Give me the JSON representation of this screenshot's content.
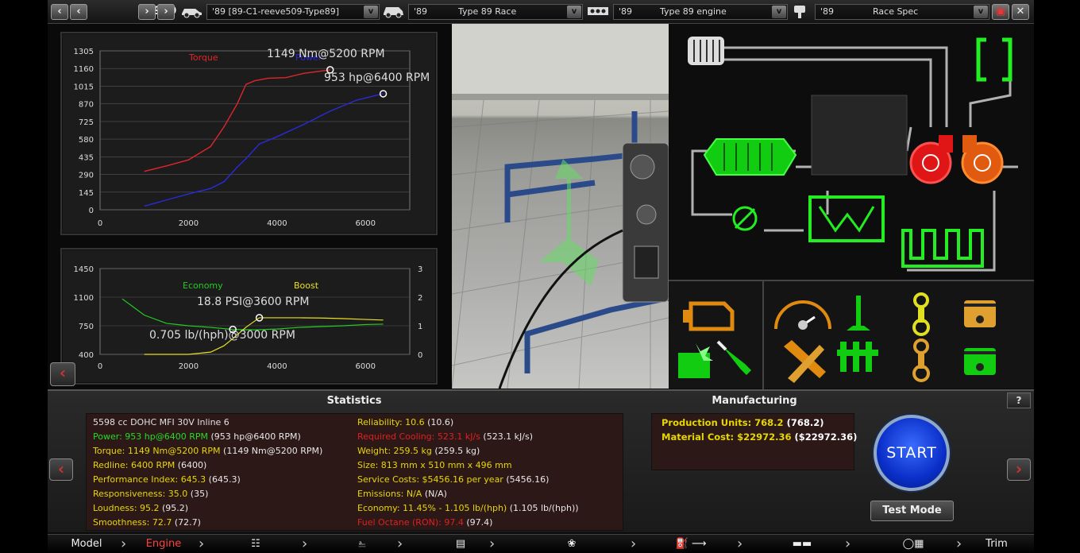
{
  "topbar": {
    "year": "1989",
    "model_select": "'89 [89-C1-reeve509-Type89]",
    "trim_select_year": "'89",
    "trim_select": "Type 89 Race",
    "engine_select_year": "'89",
    "engine_select": "Type 89 engine",
    "variant_select_year": "'89",
    "variant_select": "Race Spec"
  },
  "power_chart": {
    "legend_torque": "Torque",
    "legend_power": "Power",
    "torque_annotation": "1149 Nm@5200 RPM",
    "power_annotation": "953 hp@6400 RPM"
  },
  "eco_chart": {
    "legend_economy": "Economy",
    "legend_boost": "Boost",
    "boost_annotation": "18.8 PSI@3600 RPM",
    "economy_annotation": "0.705 lb/(hph)@3000 RPM"
  },
  "chart_data": [
    {
      "type": "line",
      "title": "",
      "xlabel": "",
      "ylabel": "",
      "x_ticks": [
        0,
        2000,
        4000,
        6000
      ],
      "y_ticks": [
        0,
        145,
        290,
        435,
        580,
        725,
        870,
        1015,
        1160,
        1305
      ],
      "xlim": [
        0,
        7000
      ],
      "ylim": [
        0,
        1305
      ],
      "series": [
        {
          "name": "Torque",
          "color": "#e0262a",
          "x": [
            1000,
            1500,
            2000,
            2500,
            2800,
            3100,
            3300,
            3500,
            3800,
            4200,
            4600,
            5200
          ],
          "y": [
            315,
            360,
            410,
            520,
            680,
            870,
            1030,
            1060,
            1080,
            1085,
            1120,
            1149
          ]
        },
        {
          "name": "Power",
          "color": "#2a2ad8",
          "x": [
            1000,
            1500,
            2000,
            2500,
            2800,
            3100,
            3300,
            3600,
            4000,
            4600,
            5200,
            5800,
            6400
          ],
          "y": [
            30,
            80,
            130,
            175,
            230,
            350,
            420,
            540,
            600,
            700,
            810,
            900,
            953
          ]
        }
      ]
    },
    {
      "type": "line",
      "title": "",
      "xlabel": "",
      "ylabel": "",
      "x_ticks": [
        0,
        2000,
        4000,
        6000
      ],
      "y_ticks_left": [
        400,
        750,
        1100,
        1450
      ],
      "y_ticks_right": [
        0,
        1,
        2,
        3
      ],
      "xlim": [
        0,
        7000
      ],
      "ylim_left": [
        400,
        1450
      ],
      "ylim_right": [
        0,
        3
      ],
      "series": [
        {
          "name": "Economy",
          "color": "#22cc22",
          "axis": "left",
          "x": [
            500,
            1000,
            1500,
            2000,
            2500,
            3000,
            3500,
            4000,
            4500,
            5000,
            5500,
            6000,
            6400
          ],
          "y": [
            1080,
            880,
            780,
            750,
            730,
            705,
            700,
            710,
            730,
            740,
            750,
            765,
            770
          ]
        },
        {
          "name": "Boost",
          "color": "#e8e020",
          "axis": "right",
          "x": [
            1000,
            2000,
            2500,
            2800,
            3000,
            3300,
            3600,
            4000,
            4500,
            5000,
            5500,
            6000,
            6400
          ],
          "y": [
            0,
            0,
            0.08,
            0.3,
            0.55,
            0.95,
            1.28,
            1.28,
            1.28,
            1.27,
            1.25,
            1.22,
            1.2
          ]
        }
      ]
    }
  ],
  "statistics": {
    "title": "Statistics",
    "col1": [
      {
        "label": "5598 cc DOHC MFI 30V Inline 6",
        "extra": "",
        "color": "#e0e0e0"
      },
      {
        "label": "Power: 953 hp@6400 RPM",
        "extra": " (953 hp@6400 RPM)",
        "color": "#22dd22"
      },
      {
        "label": "Torque: 1149 Nm@5200 RPM",
        "extra": " (1149 Nm@5200 RPM)",
        "color": "#e6d700"
      },
      {
        "label": "Redline: 6400 RPM",
        "extra": " (6400)",
        "color": "#e6d700"
      },
      {
        "label": "Performance Index: 645.3",
        "extra": " (645.3)",
        "color": "#e6d700"
      },
      {
        "label": "Responsiveness: 35.0",
        "extra": " (35)",
        "color": "#e6d700"
      },
      {
        "label": "Loudness: 95.2",
        "extra": " (95.2)",
        "color": "#e6d700"
      },
      {
        "label": "Smoothness: 72.7",
        "extra": " (72.7)",
        "color": "#e6d700"
      }
    ],
    "col2": [
      {
        "label": "Reliability: 10.6",
        "extra": " (10.6)",
        "color": "#e6d700"
      },
      {
        "label": "Required Cooling: 523.1 kJ/s",
        "extra": " (523.1 kJ/s)",
        "color": "#e02020"
      },
      {
        "label": "Weight: 259.5 kg",
        "extra": " (259.5 kg)",
        "color": "#e6d700"
      },
      {
        "label": "Size: 813 mm x 510 mm x 496 mm",
        "extra": "",
        "color": "#e6d700"
      },
      {
        "label": "Service Costs: $5456.16 per year",
        "extra": " (5456.16)",
        "color": "#e6d700"
      },
      {
        "label": "Emissions: N/A",
        "extra": " (N/A)",
        "color": "#e6d700"
      },
      {
        "label": "Economy: 11.45% - 1.105 lb/(hph)",
        "extra": " (1.105 lb/(hph))",
        "color": "#e6d700"
      },
      {
        "label": "Fuel Octane (RON): 97.4",
        "extra": " (97.4)",
        "color": "#e02020"
      }
    ]
  },
  "manufacturing": {
    "title": "Manufacturing",
    "units_label": "Production Units: 768.2",
    "units_extra": " (768.2)",
    "cost_label": "Material Cost: $22972.36",
    "cost_extra": " ($22972.36)"
  },
  "controls": {
    "start": "START",
    "test_mode": "Test Mode",
    "help": "?"
  },
  "tabs": {
    "model": "Model",
    "engine": "Engine",
    "trim": "Trim"
  },
  "colors": {
    "accent_red": "#ff4040",
    "start_blue": "#1d4de8",
    "ok_green": "#22dd22",
    "warn_yellow": "#e6d700"
  }
}
